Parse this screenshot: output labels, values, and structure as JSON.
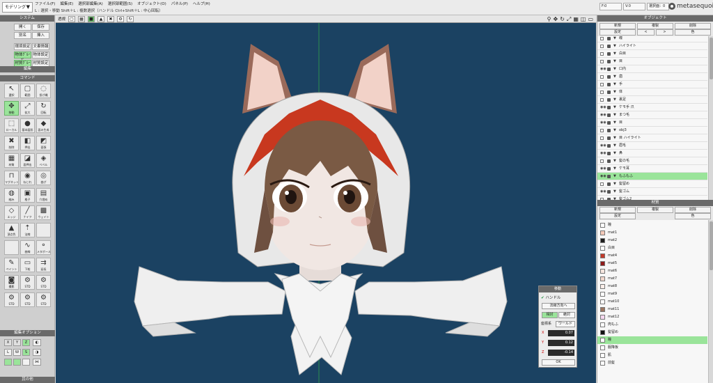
{
  "mode": {
    "label": "モデリング"
  },
  "menu": [
    "ファイル(F)",
    "編集(E)",
    "選択部編集(A)",
    "選択部範囲(S)",
    "オブジェクト(O)",
    "パネル(P)",
    "ヘルプ(H)"
  ],
  "hint": "L : 選択・移動  Shift＋L : 複数選択（ハンドル  Ctrl+Shift＋L : 中心回転）",
  "coords": {
    "f": "F:0",
    "v": "V:0",
    "sel": "選択面：0"
  },
  "logo": {
    "name": "metasequoia",
    "version": "4"
  },
  "left": {
    "system_header": "システム",
    "system_buttons": [
      "開く",
      "保存",
      "別名",
      "挿入",
      "環境設定",
      "文書情報",
      "物体ｸﾞﾙｰﾌﾟ",
      "物体設定",
      "材質ｸﾞﾙｰﾌﾟ",
      "材質設定"
    ],
    "edit_header": "編集",
    "command_header": "コマンド",
    "tools": [
      {
        "label": "選択",
        "icon": "↖",
        "name": "select-tool",
        "hl": false
      },
      {
        "label": "範囲",
        "icon": "▢",
        "name": "range-tool",
        "hl": false
      },
      {
        "label": "投げ縄",
        "icon": "◌",
        "name": "lasso-tool",
        "hl": false
      },
      {
        "label": "移動",
        "icon": "✥",
        "name": "move-tool",
        "hl": true
      },
      {
        "label": "拡大",
        "icon": "⤢",
        "name": "scale-tool",
        "hl": false
      },
      {
        "label": "回転",
        "icon": "↻",
        "name": "rotate-tool",
        "hl": false
      },
      {
        "label": "ローカル",
        "icon": "⬚",
        "name": "local-tool",
        "hl": false
      },
      {
        "label": "基本図形",
        "icon": "●",
        "name": "primitive-tool",
        "hl": false
      },
      {
        "label": "面の生成",
        "icon": "◆",
        "name": "create-face-tool",
        "hl": false
      },
      {
        "label": "削除",
        "icon": "✖",
        "name": "delete-tool",
        "hl": false
      },
      {
        "label": "押出",
        "icon": "◧",
        "name": "extrude-tool",
        "hl": false
      },
      {
        "label": "面張",
        "icon": "◩",
        "name": "face-tool",
        "hl": false
      },
      {
        "label": "材質",
        "icon": "▦",
        "name": "material-tool",
        "hl": false
      },
      {
        "label": "面押出",
        "icon": "◪",
        "name": "face-extrude-tool",
        "hl": false
      },
      {
        "label": "ベベル",
        "icon": "◈",
        "name": "bevel-tool",
        "hl": false
      },
      {
        "label": "マグネット",
        "icon": "⊓",
        "name": "magnet-tool",
        "hl": false
      },
      {
        "label": "ねじれ",
        "icon": "◉",
        "name": "twist-tool",
        "hl": false
      },
      {
        "label": "曲げ",
        "icon": "◎",
        "name": "bend-tool",
        "hl": false
      },
      {
        "label": "縮み",
        "icon": "◍",
        "name": "shrink-tool",
        "hl": false
      },
      {
        "label": "格子",
        "icon": "▣",
        "name": "lattice-tool",
        "hl": false
      },
      {
        "label": "穴埋め",
        "icon": "▤",
        "name": "fill-tool",
        "hl": false
      },
      {
        "label": "エッジ",
        "icon": "◇",
        "name": "edge-tool",
        "hl": false
      },
      {
        "label": "ナイフ",
        "icon": "╱",
        "name": "knife-tool",
        "hl": false
      },
      {
        "label": "ウェイト",
        "icon": "▩",
        "name": "weight-tool",
        "hl": false
      },
      {
        "label": "頂点色",
        "icon": "▲",
        "name": "vertex-color-tool",
        "hl": false
      },
      {
        "label": "法線",
        "icon": "⇡",
        "name": "normal-tool",
        "hl": false
      },
      {
        "label": "",
        "icon": "",
        "name": "empty-tool-1",
        "hl": false
      },
      {
        "label": "",
        "icon": "",
        "name": "empty-tool-2",
        "hl": false
      },
      {
        "label": "曲線",
        "icon": "∿",
        "name": "curve-tool",
        "hl": false
      },
      {
        "label": "メタボール",
        "icon": "⚬",
        "name": "metaball-tool",
        "hl": false
      },
      {
        "label": "ペイント",
        "icon": "✎",
        "name": "paint-tool",
        "hl": false
      },
      {
        "label": "下絵",
        "icon": "▭",
        "name": "underlay-tool",
        "hl": false
      },
      {
        "label": "延長",
        "icon": "⇉",
        "name": "extend-tool",
        "hl": false
      },
      {
        "label": "撮影",
        "icon": "◙",
        "name": "camera-tool",
        "hl": false
      },
      {
        "label": "STD",
        "icon": "⚙",
        "name": "std-tool-1",
        "hl": false
      },
      {
        "label": "STD",
        "icon": "⚙",
        "name": "std-tool-2",
        "hl": false
      },
      {
        "label": "STD",
        "icon": "⚙",
        "name": "std-tool-3",
        "hl": false
      },
      {
        "label": "STD",
        "icon": "⚙",
        "name": "std-tool-4",
        "hl": false
      },
      {
        "label": "STD",
        "icon": "⚙",
        "name": "std-tool-5",
        "hl": false
      }
    ],
    "edit_option_header": "編集オプション",
    "opt_row1": [
      "X",
      "Y",
      "Z"
    ],
    "opt_row2": [
      "L",
      "W",
      "S"
    ],
    "bottom_header": "其の他"
  },
  "viewport": {
    "mode_label": "透視",
    "right_icons": [
      "⚲",
      "✥",
      "↻",
      "⤢",
      "▦",
      "◫",
      "▭"
    ]
  },
  "move_dialog": {
    "title": "移動",
    "handle_label": "ハンドル",
    "handle_check": "✔",
    "dir_button": "法線方向へ",
    "relative": "相対",
    "absolute": "絶対",
    "coord_label": "座標系",
    "coord_value": "ワールド",
    "axes": [
      "X",
      "Y",
      "Z"
    ],
    "values": [
      "0.07",
      "0.12",
      "-0.14"
    ],
    "ok": "OK"
  },
  "object_panel": {
    "header": "オブジェクト",
    "buttons": [
      "新規",
      "複製",
      "削除",
      "設定",
      "<",
      ">",
      "色"
    ],
    "rows": [
      {
        "name": "瞳",
        "vis": false,
        "sel": false
      },
      {
        "name": "ハイライト",
        "vis": false,
        "sel": false
      },
      {
        "name": "白目",
        "vis": false,
        "sel": false
      },
      {
        "name": "目",
        "vis": false,
        "sel": false
      },
      {
        "name": "口内",
        "vis": true,
        "sel": false
      },
      {
        "name": "歯",
        "vis": false,
        "sel": false
      },
      {
        "name": "手",
        "vis": false,
        "sel": false
      },
      {
        "name": "体",
        "vis": false,
        "sel": false
      },
      {
        "name": "裏足",
        "vis": false,
        "sel": false
      },
      {
        "name": "ケモ手 爪",
        "vis": true,
        "sel": false
      },
      {
        "name": "まつ毛",
        "vis": true,
        "sel": false
      },
      {
        "name": "目",
        "vis": true,
        "sel": false
      },
      {
        "name": "obj3",
        "vis": false,
        "sel": false
      },
      {
        "name": "目 ハイライト",
        "vis": false,
        "sel": false
      },
      {
        "name": "眉毛",
        "vis": true,
        "sel": false
      },
      {
        "name": "鼻",
        "vis": true,
        "sel": false
      },
      {
        "name": "髪の毛",
        "vis": false,
        "sel": false
      },
      {
        "name": "ケモ耳",
        "vis": true,
        "sel": false
      },
      {
        "name": "もふもふ",
        "vis": true,
        "sel": true
      },
      {
        "name": "髪留め",
        "vis": false,
        "sel": false
      },
      {
        "name": "髪ゴム",
        "vis": true,
        "sel": false
      },
      {
        "name": "髪ゴム2",
        "vis": false,
        "sel": false
      }
    ]
  },
  "material_panel": {
    "header": "材質",
    "buttons": [
      "新規",
      "複製",
      "削除",
      "設定",
      "色"
    ],
    "rows": [
      {
        "name": "瞳",
        "color": "#ffffff",
        "sel": false
      },
      {
        "name": "mat1",
        "color": "#f4c9b8",
        "sel": false
      },
      {
        "name": "mat2",
        "color": "#1e1e1e",
        "sel": false
      },
      {
        "name": "白目",
        "color": "#ffffff",
        "sel": false
      },
      {
        "name": "mat4",
        "color": "#c33a2a",
        "sel": false
      },
      {
        "name": "mat5",
        "color": "#8f1b1b",
        "sel": false
      },
      {
        "name": "mat6",
        "color": "#f7e7e0",
        "sel": false
      },
      {
        "name": "mat7",
        "color": "#f1d6cb",
        "sel": false
      },
      {
        "name": "mat8",
        "color": "#fbeee9",
        "sel": false
      },
      {
        "name": "mat9",
        "color": "#ffffff",
        "sel": false
      },
      {
        "name": "mat10",
        "color": "#ffffff",
        "sel": false
      },
      {
        "name": "mat11",
        "color": "#9c7560",
        "sel": false
      },
      {
        "name": "mat12",
        "color": "#f7d8f0",
        "sel": false
      },
      {
        "name": "肉もふ",
        "color": "#ffffff",
        "sel": false
      },
      {
        "name": "髪留め",
        "color": "#111111",
        "sel": false
      },
      {
        "name": "瞳",
        "color": "#ffffff",
        "sel": true
      },
      {
        "name": "服降板",
        "color": "#ffffff",
        "sel": false
      },
      {
        "name": "肌",
        "color": "#ffffff",
        "sel": false
      },
      {
        "name": "前髪",
        "color": "#ffffff",
        "sel": false
      }
    ]
  },
  "colors": {
    "accent": "#9ae49a",
    "viewport_bg": "#1b4262",
    "hood_red": "#c8381f",
    "hair": "#7a5a44"
  }
}
